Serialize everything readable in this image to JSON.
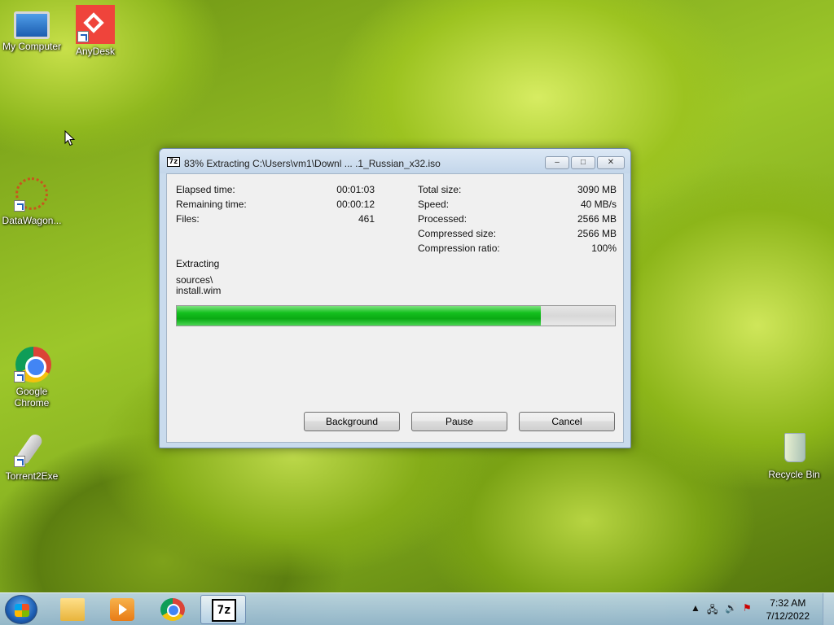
{
  "desktop": {
    "icons": [
      {
        "label": "My Computer",
        "icon": "computer-icon"
      },
      {
        "label": "AnyDesk",
        "icon": "anydesk-icon"
      },
      {
        "label": "DataWagon...",
        "icon": "datawagon-icon"
      },
      {
        "label": "Google Chrome",
        "icon": "chrome-icon"
      },
      {
        "label": "Torrent2Exe",
        "icon": "torrent2exe-icon"
      },
      {
        "label": "Recycle Bin",
        "icon": "recycle-bin-icon"
      }
    ]
  },
  "dialog": {
    "title": "83% Extracting C:\\Users\\vm1\\Downl ... .1_Russian_x32.iso",
    "app_icon_text": "7z",
    "stats_left": [
      {
        "label": "Elapsed time:",
        "value": "00:01:03"
      },
      {
        "label": "Remaining time:",
        "value": "00:00:12"
      },
      {
        "label": "Files:",
        "value": "461"
      }
    ],
    "stats_right": [
      {
        "label": "Total size:",
        "value": "3090 MB"
      },
      {
        "label": "Speed:",
        "value": "40 MB/s"
      },
      {
        "label": "Processed:",
        "value": "2566 MB"
      },
      {
        "label": "Compressed size:",
        "value": "2566 MB"
      },
      {
        "label": "Compression ratio:",
        "value": "100%"
      }
    ],
    "status_label": "Extracting",
    "current_folder": "sources\\",
    "current_file": "install.wim",
    "progress_fraction": 0.83,
    "buttons": {
      "background": "Background",
      "pause": "Pause",
      "cancel": "Cancel"
    }
  },
  "taskbar": {
    "items": [
      "windows-explorer-icon",
      "media-player-icon",
      "chrome-icon",
      "7zip-icon"
    ],
    "active_item_label": "7z",
    "clock": {
      "time": "7:32 AM",
      "date": "7/12/2022"
    }
  }
}
